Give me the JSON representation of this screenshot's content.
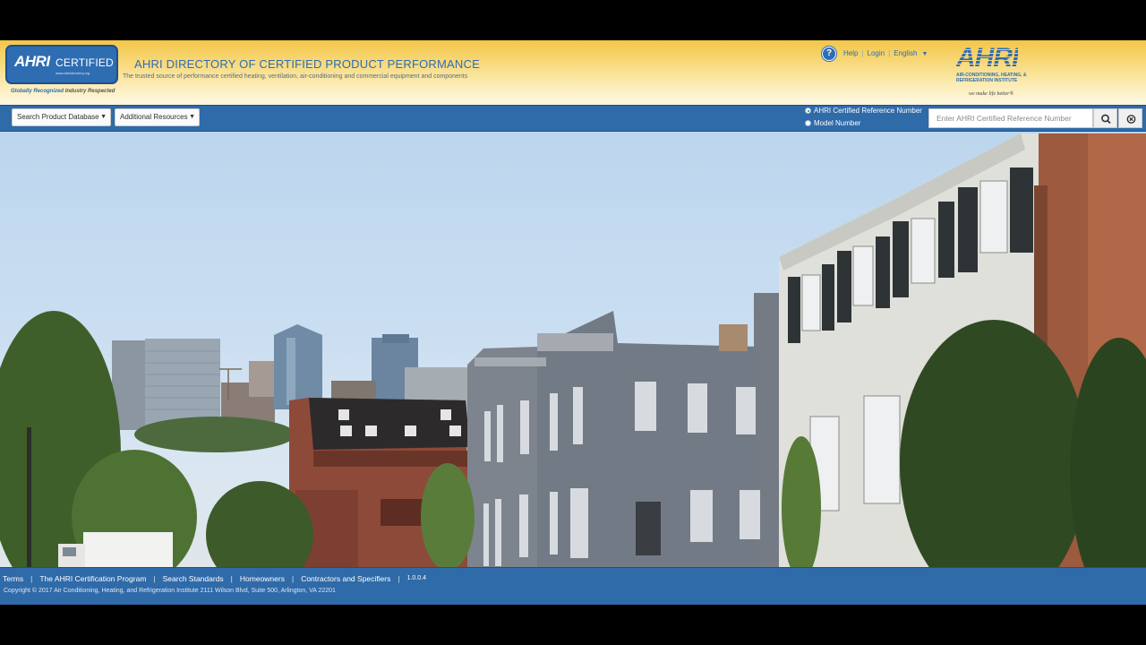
{
  "header": {
    "logo_ahri": "AHRI",
    "logo_certified": "CERTIFIED",
    "logo_url": "www.ahridirectory.org",
    "logo_tagline_1": "Globally Recognized",
    "logo_tagline_2": "Industry Respected",
    "title": "AHRI DIRECTORY OF CERTIFIED PRODUCT PERFORMANCE",
    "subtitle": "The trusted source of performance certified heating, ventilation, air-conditioning and commercial equipment and components",
    "help_label": "Help",
    "login_label": "Login",
    "language_label": "English",
    "org_logo_text": "AHRI",
    "org_logo_desc": "AIR-CONDITIONING, HEATING, & REFRIGERATION INSTITUTE",
    "org_motto": "we make life better"
  },
  "nav": {
    "search_db_label": "Search Product Database",
    "resources_label": "Additional Resources",
    "radio_ref_label": "AHRI Certified Reference Number",
    "radio_model_label": "Model Number",
    "search_placeholder": "Enter AHRI Certified Reference Number",
    "search_value": ""
  },
  "footer": {
    "links": [
      "Terms",
      "The AHRI Certification Program",
      "Search Standards",
      "Homeowners",
      "Contractors and Specifiers"
    ],
    "version": "1.0.0.4",
    "copyright": "Copyright © 2017 Air Conditioning, Heating, and Refrigeration Institute  2111 Wilson Blvd, Suite 500, Arlington, VA 22201"
  },
  "colors": {
    "brand_blue": "#2f6aa9",
    "header_gold": "#f3c64a"
  },
  "icons": {
    "help": "question-circle-icon",
    "search": "magnifier-icon",
    "clear": "circle-x-icon",
    "caret": "caret-down-icon"
  }
}
